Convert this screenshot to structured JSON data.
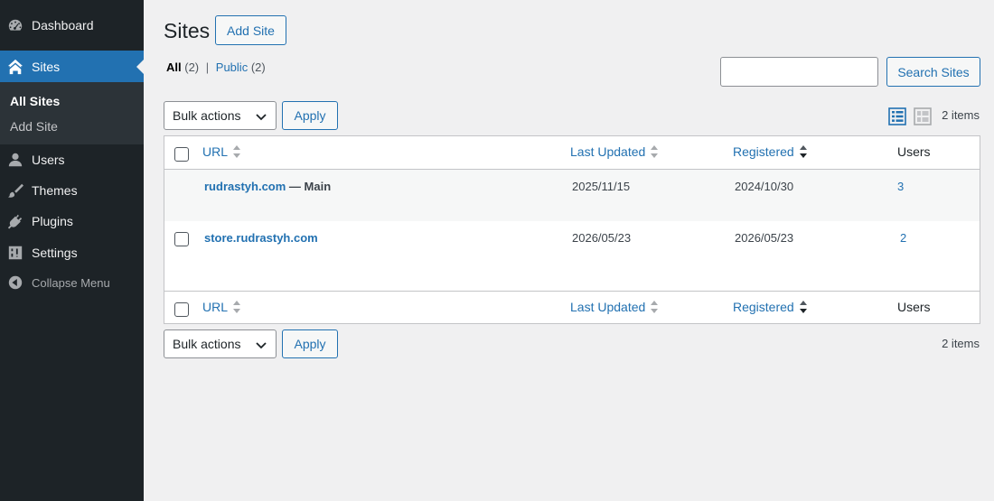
{
  "sidebar": {
    "dashboard": "Dashboard",
    "sites": "Sites",
    "submenu": {
      "all_sites": "All Sites",
      "add_site": "Add Site"
    },
    "users": "Users",
    "themes": "Themes",
    "plugins": "Plugins",
    "settings": "Settings",
    "collapse": "Collapse Menu"
  },
  "header": {
    "title": "Sites",
    "add_site_label": "Add Site"
  },
  "filters": {
    "all_label": "All",
    "all_count": "(2)",
    "separator": "|",
    "public_label": "Public",
    "public_count": "(2)"
  },
  "search": {
    "value": "",
    "placeholder": "",
    "button_label": "Search Sites"
  },
  "bulk": {
    "selected": "Bulk actions",
    "apply_label": "Apply"
  },
  "items_count": "2 items",
  "table": {
    "columns": {
      "url": "URL",
      "last_updated": "Last Updated",
      "registered": "Registered",
      "users": "Users"
    },
    "rows": [
      {
        "url": "rudrastyh.com",
        "suffix": " — Main",
        "last_updated": "2025/11/15",
        "registered": "2024/10/30",
        "users": "3"
      },
      {
        "url": "store.rudrastyh.com",
        "suffix": "",
        "last_updated": "2026/05/23",
        "registered": "2026/05/23",
        "users": "2"
      }
    ]
  },
  "colors": {
    "accent": "#2271b1",
    "sidebar_bg": "#1d2327",
    "submenu_bg": "#2c3338",
    "page_bg": "#f0f0f1"
  }
}
